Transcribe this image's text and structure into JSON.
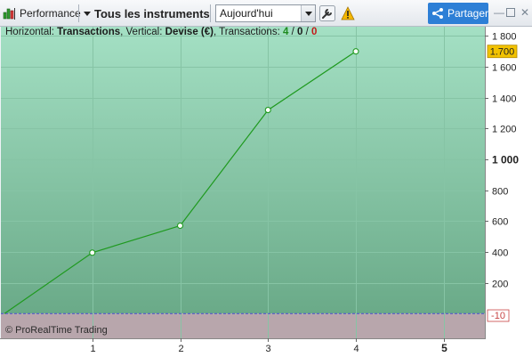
{
  "toolbar": {
    "performance_label": "Performance",
    "instruments_label": "Tous les instruments",
    "period_value": "Aujourd'hui",
    "share_label": "Partager",
    "icons": [
      "performance-chart-icon",
      "dropdown-caret-icon",
      "wrench-icon",
      "warning-icon",
      "share-icon",
      "minimize-icon",
      "maximize-icon",
      "close-icon"
    ]
  },
  "info": {
    "horizontal_label": "Horizontal:",
    "horizontal_value": "Transactions",
    "vertical_label": ", Vertical:",
    "vertical_value": "Devise (€)",
    "transactions_label": ", Transactions:",
    "tx_won": "4",
    "sep1": " / ",
    "tx_neutral": "0",
    "sep2": " / ",
    "tx_lost": "0"
  },
  "copyright": "© ProRealTime Trading",
  "colors": {
    "area_top": "#a4e0c4",
    "area_bottom": "#6aaa88",
    "negative_area": "#b8a6ac",
    "line": "#1f9a1f",
    "current_value_bg": "#f2c200",
    "negative_tag": "#c84444",
    "share_button": "#2d7fd6"
  },
  "chart_data": {
    "type": "line",
    "x": [
      0,
      1,
      2,
      3,
      4
    ],
    "y": [
      0,
      395,
      570,
      1320,
      1700
    ],
    "xlim": [
      0,
      5.5
    ],
    "ylim": [
      -160,
      1860
    ],
    "x_ticks": [
      "1",
      "2",
      "3",
      "4",
      "5"
    ],
    "y_ticks": [
      "1 800",
      "1 600",
      "1 400",
      "1 200",
      "1 000",
      "800",
      "600",
      "400",
      "200"
    ],
    "y_tick_values": [
      1800,
      1600,
      1400,
      1200,
      1000,
      800,
      600,
      400,
      200
    ],
    "bold_y_tick": "1 000",
    "bold_x_tick": "5",
    "current_value_label": "1.700",
    "current_value": 1700,
    "zero_tag_label": "-10",
    "zero_tag_value": -10,
    "grid": true
  }
}
